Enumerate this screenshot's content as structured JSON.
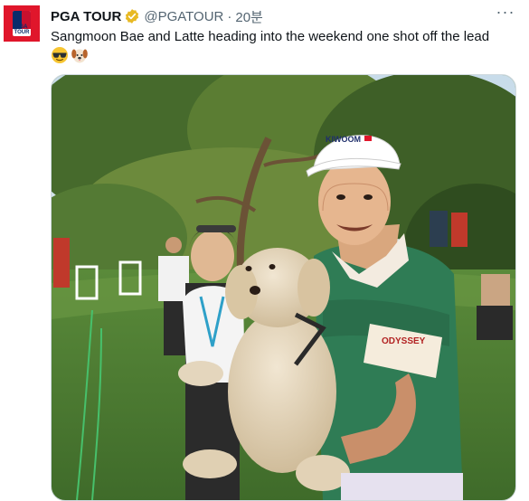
{
  "account": {
    "name": "PGA TOUR",
    "handle": "@PGATOUR",
    "time": "20분",
    "avatar_logo_text": "PGA TOUR"
  },
  "tweet": {
    "text": "Sangmoon Bae and Latte heading into the weekend one shot off the lead",
    "emojis": [
      "sunglasses-face-emoji",
      "dog-face-emoji"
    ]
  },
  "media": {
    "cap_brand": "KIWOOM",
    "sleeve_brand": "ODYSSEY"
  },
  "icons": {
    "more": "more-options-icon",
    "verified": "gold-verified-badge-icon"
  },
  "colors": {
    "verified_gold": "#e8b923",
    "brand_red": "#e0162b",
    "secondary_text": "#536471"
  }
}
